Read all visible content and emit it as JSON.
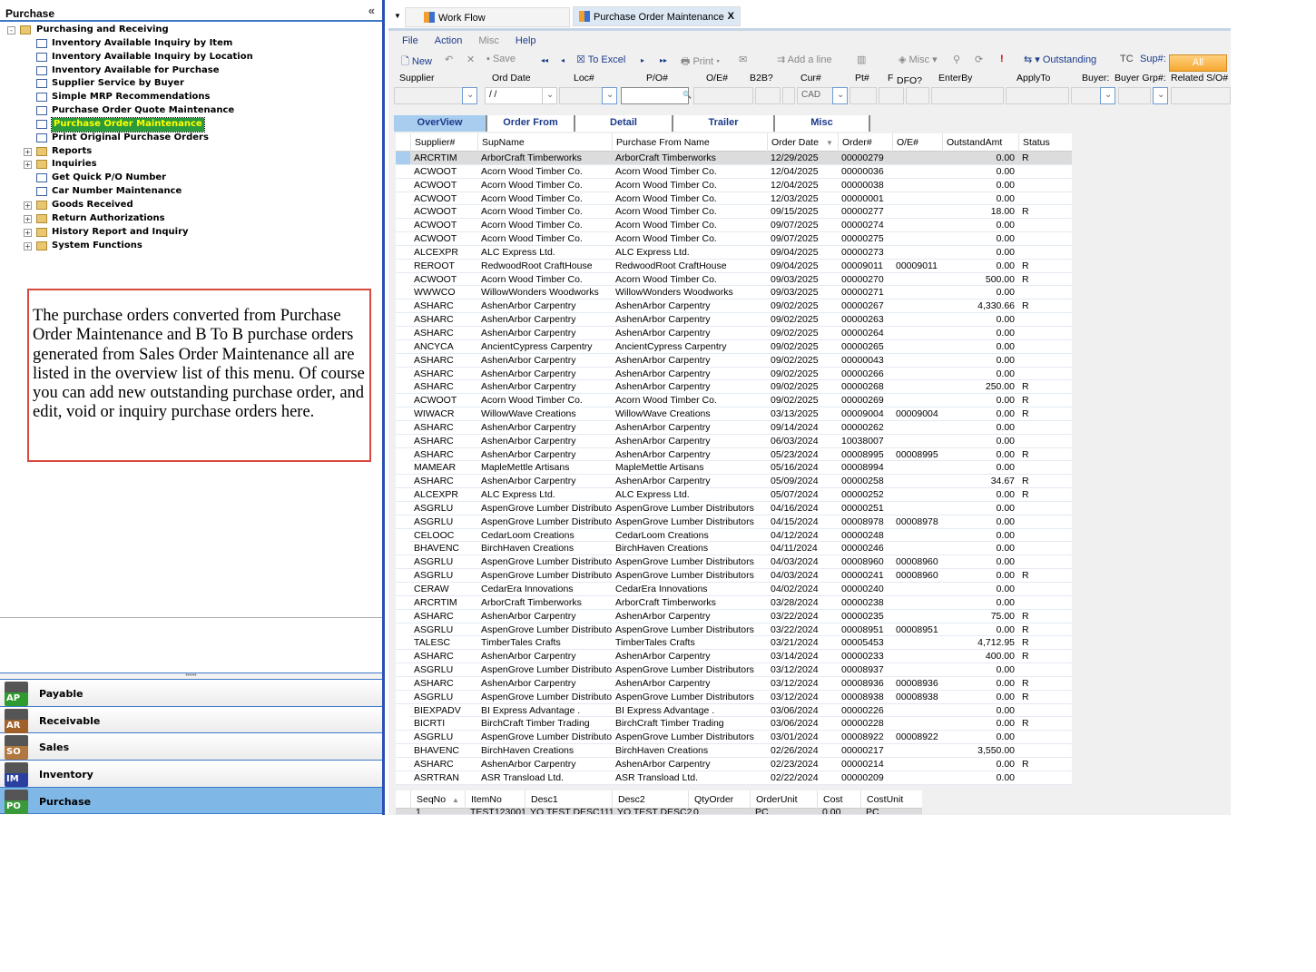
{
  "sidebar": {
    "title": "Purchase",
    "collapse_icon": "double-chevron-left",
    "tree": [
      {
        "label": "Purchasing and Receiving",
        "level": 0,
        "type": "folder",
        "expand": "-"
      },
      {
        "label": "Inventory Available Inquiry by Item",
        "level": 1,
        "type": "page"
      },
      {
        "label": "Inventory Available Inquiry by Location",
        "level": 1,
        "type": "page"
      },
      {
        "label": "Inventory Available for Purchase",
        "level": 1,
        "type": "page"
      },
      {
        "label": "Supplier Service by Buyer",
        "level": 1,
        "type": "page"
      },
      {
        "label": "Simple MRP Recommendations",
        "level": 1,
        "type": "page"
      },
      {
        "label": "Purchase Order Quote Maintenance",
        "level": 1,
        "type": "page"
      },
      {
        "label": "Purchase Order Maintenance",
        "level": 1,
        "type": "page",
        "selected": true
      },
      {
        "label": "Print Original Purchase Orders",
        "level": 1,
        "type": "page"
      },
      {
        "label": "Reports",
        "level": 1,
        "type": "folder",
        "expand": "+"
      },
      {
        "label": "Inquiries",
        "level": 1,
        "type": "folder",
        "expand": "+"
      },
      {
        "label": "Get Quick P/O Number",
        "level": 1,
        "type": "page"
      },
      {
        "label": "Car Number Maintenance",
        "level": 1,
        "type": "page"
      },
      {
        "label": "Goods Received",
        "level": 1,
        "type": "folder",
        "expand": "+"
      },
      {
        "label": "Return Authorizations",
        "level": 1,
        "type": "folder",
        "expand": "+"
      },
      {
        "label": "History Report and Inquiry",
        "level": 1,
        "type": "folder",
        "expand": "+"
      },
      {
        "label": "System Functions",
        "level": 1,
        "type": "folder",
        "expand": "+"
      }
    ],
    "note": "The purchase orders converted from Purchase Order Maintenance and B To B purchase orders generated from Sales Order Maintenance all are listed in the overview list of this menu. Of course you can add new outstanding purchase order, and edit, void or inquiry purchase orders here.",
    "modules": [
      {
        "label": "Payable",
        "badge": "AP",
        "color": "#2f9a2f"
      },
      {
        "label": "Receivable",
        "badge": "AR",
        "color": "#a0602a"
      },
      {
        "label": "Sales",
        "badge": "SO",
        "color": "#b07840"
      },
      {
        "label": "Inventory",
        "badge": "IM",
        "color": "#2a3fa0"
      },
      {
        "label": "Purchase",
        "badge": "PO",
        "color": "#3a9a3a",
        "active": true
      }
    ]
  },
  "doc_tabs": [
    {
      "label": "Work Flow"
    },
    {
      "label": "Purchase Order Maintenance",
      "active": true,
      "close": "X"
    }
  ],
  "menu": [
    "File",
    "Action",
    "Misc",
    "Help"
  ],
  "toolbar": {
    "new": "New",
    "save": "Save",
    "to_excel": "To Excel",
    "print": "Print",
    "add_line": "Add a line",
    "misc": "Misc",
    "outstanding": "Outstanding",
    "tc": "TC",
    "sup": "Sup#:",
    "all": "All"
  },
  "filters": {
    "labels": [
      "Supplier",
      "Ord Date",
      "Loc#",
      "P/O#",
      "O/E#",
      "B2B?",
      "Cur#",
      "Pt#",
      "F",
      "DFO?",
      "EnterBy",
      "ApplyTo",
      "Buyer:",
      "Buyer Grp#:",
      "Related S/O#"
    ],
    "ord_date": " /  /",
    "currency": "CAD"
  },
  "subtabs": [
    {
      "label": "OverView",
      "active": true
    },
    {
      "label": "Order From"
    },
    {
      "label": "Detail"
    },
    {
      "label": "Trailer"
    },
    {
      "label": "Misc"
    }
  ],
  "grid": {
    "columns": [
      "Supplier#",
      "SupName",
      "Purchase From Name",
      "Order Date",
      "Order#",
      "O/E#",
      "OutstandAmt",
      "Status"
    ],
    "sort_column": "Order Date",
    "rows": [
      [
        "ARCRTIM",
        "ArborCraft Timberworks",
        "ArborCraft Timberworks",
        "12/29/2025",
        "00000279",
        "",
        "0.00",
        "R"
      ],
      [
        "ACWOOT",
        "Acorn Wood Timber Co.",
        "Acorn Wood Timber Co.",
        "12/04/2025",
        "00000036",
        "",
        "0.00",
        ""
      ],
      [
        "ACWOOT",
        "Acorn Wood Timber Co.",
        "Acorn Wood Timber Co.",
        "12/04/2025",
        "00000038",
        "",
        "0.00",
        ""
      ],
      [
        "ACWOOT",
        "Acorn Wood Timber Co.",
        "Acorn Wood Timber Co.",
        "12/03/2025",
        "00000001",
        "",
        "0.00",
        ""
      ],
      [
        "ACWOOT",
        "Acorn Wood Timber Co.",
        "Acorn Wood Timber Co.",
        "09/15/2025",
        "00000277",
        "",
        "18.00",
        "R"
      ],
      [
        "ACWOOT",
        "Acorn Wood Timber Co.",
        "Acorn Wood Timber Co.",
        "09/07/2025",
        "00000274",
        "",
        "0.00",
        ""
      ],
      [
        "ACWOOT",
        "Acorn Wood Timber Co.",
        "Acorn Wood Timber Co.",
        "09/07/2025",
        "00000275",
        "",
        "0.00",
        ""
      ],
      [
        "ALCEXPR",
        "ALC Express Ltd.",
        "ALC Express Ltd.",
        "09/04/2025",
        "00000273",
        "",
        "0.00",
        ""
      ],
      [
        "REROOT",
        "RedwoodRoot CraftHouse",
        "RedwoodRoot CraftHouse",
        "09/04/2025",
        "00009011",
        "00009011",
        "0.00",
        "R"
      ],
      [
        "ACWOOT",
        "Acorn Wood Timber Co.",
        "Acorn Wood Timber Co.",
        "09/03/2025",
        "00000270",
        "",
        "500.00",
        "R"
      ],
      [
        "WWWCO",
        "WillowWonders Woodworks",
        "WillowWonders Woodworks",
        "09/03/2025",
        "00000271",
        "",
        "0.00",
        ""
      ],
      [
        "ASHARC",
        "AshenArbor Carpentry",
        "AshenArbor Carpentry",
        "09/02/2025",
        "00000267",
        "",
        "4,330.66",
        "R"
      ],
      [
        "ASHARC",
        "AshenArbor Carpentry",
        "AshenArbor Carpentry",
        "09/02/2025",
        "00000263",
        "",
        "0.00",
        ""
      ],
      [
        "ASHARC",
        "AshenArbor Carpentry",
        "AshenArbor Carpentry",
        "09/02/2025",
        "00000264",
        "",
        "0.00",
        ""
      ],
      [
        "ANCYCA",
        "AncientCypress Carpentry",
        "AncientCypress Carpentry",
        "09/02/2025",
        "00000265",
        "",
        "0.00",
        ""
      ],
      [
        "ASHARC",
        "AshenArbor Carpentry",
        "AshenArbor Carpentry",
        "09/02/2025",
        "00000043",
        "",
        "0.00",
        ""
      ],
      [
        "ASHARC",
        "AshenArbor Carpentry",
        "AshenArbor Carpentry",
        "09/02/2025",
        "00000266",
        "",
        "0.00",
        ""
      ],
      [
        "ASHARC",
        "AshenArbor Carpentry",
        "AshenArbor Carpentry",
        "09/02/2025",
        "00000268",
        "",
        "250.00",
        "R"
      ],
      [
        "ACWOOT",
        "Acorn Wood Timber Co.",
        "Acorn Wood Timber Co.",
        "09/02/2025",
        "00000269",
        "",
        "0.00",
        "R"
      ],
      [
        "WIWACR",
        "WillowWave Creations",
        "WillowWave Creations",
        "03/13/2025",
        "00009004",
        "00009004",
        "0.00",
        "R"
      ],
      [
        "ASHARC",
        "AshenArbor Carpentry",
        "AshenArbor Carpentry",
        "09/14/2024",
        "00000262",
        "",
        "0.00",
        ""
      ],
      [
        "ASHARC",
        "AshenArbor Carpentry",
        "AshenArbor Carpentry",
        "06/03/2024",
        "10038007",
        "",
        "0.00",
        ""
      ],
      [
        "ASHARC",
        "AshenArbor Carpentry",
        "AshenArbor Carpentry",
        "05/23/2024",
        "00008995",
        "00008995",
        "0.00",
        "R"
      ],
      [
        "MAMEAR",
        "MapleMettle Artisans",
        "MapleMettle Artisans",
        "05/16/2024",
        "00008994",
        "",
        "0.00",
        ""
      ],
      [
        "ASHARC",
        "AshenArbor Carpentry",
        "AshenArbor Carpentry",
        "05/09/2024",
        "00000258",
        "",
        "34.67",
        "R"
      ],
      [
        "ALCEXPR",
        "ALC Express Ltd.",
        "ALC Express Ltd.",
        "05/07/2024",
        "00000252",
        "",
        "0.00",
        "R"
      ],
      [
        "ASGRLU",
        "AspenGrove Lumber Distributors",
        "AspenGrove Lumber Distributors",
        "04/16/2024",
        "00000251",
        "",
        "0.00",
        ""
      ],
      [
        "ASGRLU",
        "AspenGrove Lumber Distributors",
        "AspenGrove Lumber Distributors",
        "04/15/2024",
        "00008978",
        "00008978",
        "0.00",
        ""
      ],
      [
        "CELOOC",
        "CedarLoom Creations",
        "CedarLoom Creations",
        "04/12/2024",
        "00000248",
        "",
        "0.00",
        ""
      ],
      [
        "BHAVENC",
        "BirchHaven Creations",
        "BirchHaven Creations",
        "04/11/2024",
        "00000246",
        "",
        "0.00",
        ""
      ],
      [
        "ASGRLU",
        "AspenGrove Lumber Distributors",
        "AspenGrove Lumber Distributors",
        "04/03/2024",
        "00008960",
        "00008960",
        "0.00",
        ""
      ],
      [
        "ASGRLU",
        "AspenGrove Lumber Distributors",
        "AspenGrove Lumber Distributors",
        "04/03/2024",
        "00000241",
        "00008960",
        "0.00",
        "R"
      ],
      [
        "CERAW",
        "CedarEra Innovations",
        "CedarEra Innovations",
        "04/02/2024",
        "00000240",
        "",
        "0.00",
        ""
      ],
      [
        "ARCRTIM",
        "ArborCraft Timberworks",
        "ArborCraft Timberworks",
        "03/28/2024",
        "00000238",
        "",
        "0.00",
        ""
      ],
      [
        "ASHARC",
        "AshenArbor Carpentry",
        "AshenArbor Carpentry",
        "03/22/2024",
        "00000235",
        "",
        "75.00",
        "R"
      ],
      [
        "ASGRLU",
        "AspenGrove Lumber Distributors",
        "AspenGrove Lumber Distributors",
        "03/22/2024",
        "00008951",
        "00008951",
        "0.00",
        "R"
      ],
      [
        "TALESC",
        "TimberTales Crafts",
        "TimberTales Crafts",
        "03/21/2024",
        "00005453",
        "",
        "4,712.95",
        "R"
      ],
      [
        "ASHARC",
        "AshenArbor Carpentry",
        "AshenArbor Carpentry",
        "03/14/2024",
        "00000233",
        "",
        "400.00",
        "R"
      ],
      [
        "ASGRLU",
        "AspenGrove Lumber Distributors",
        "AspenGrove Lumber Distributors",
        "03/12/2024",
        "00008937",
        "",
        "0.00",
        ""
      ],
      [
        "ASHARC",
        "AshenArbor Carpentry",
        "AshenArbor Carpentry",
        "03/12/2024",
        "00008936",
        "00008936",
        "0.00",
        "R"
      ],
      [
        "ASGRLU",
        "AspenGrove Lumber Distributors",
        "AspenGrove Lumber Distributors",
        "03/12/2024",
        "00008938",
        "00008938",
        "0.00",
        "R"
      ],
      [
        "BIEXPADV",
        "BI Express Advantage .",
        "BI Express Advantage .",
        "03/06/2024",
        "00000226",
        "",
        "0.00",
        ""
      ],
      [
        "BICRTI",
        "BirchCraft Timber Trading",
        "BirchCraft Timber Trading",
        "03/06/2024",
        "00000228",
        "",
        "0.00",
        "R"
      ],
      [
        "ASGRLU",
        "AspenGrove Lumber Distributors",
        "AspenGrove Lumber Distributors",
        "03/01/2024",
        "00008922",
        "00008922",
        "0.00",
        ""
      ],
      [
        "BHAVENC",
        "BirchHaven Creations",
        "BirchHaven Creations",
        "02/26/2024",
        "00000217",
        "",
        "3,550.00",
        ""
      ],
      [
        "ASHARC",
        "AshenArbor Carpentry",
        "AshenArbor Carpentry",
        "02/23/2024",
        "00000214",
        "",
        "0.00",
        "R"
      ],
      [
        "ASRTRAN",
        "ASR Transload Ltd.",
        "ASR Transload Ltd.",
        "02/22/2024",
        "00000209",
        "",
        "0.00",
        ""
      ]
    ]
  },
  "detail_grid": {
    "columns": [
      "SeqNo",
      "ItemNo",
      "Desc1",
      "Desc2",
      "QtyOrder",
      "OrderUnit",
      "Cost",
      "CostUnit"
    ],
    "rows": [
      [
        "1",
        "TEST123001",
        "YQ TEST DESC111",
        "YQ TEST DESC2",
        "0",
        "PC",
        "0.00",
        "PC"
      ]
    ]
  }
}
